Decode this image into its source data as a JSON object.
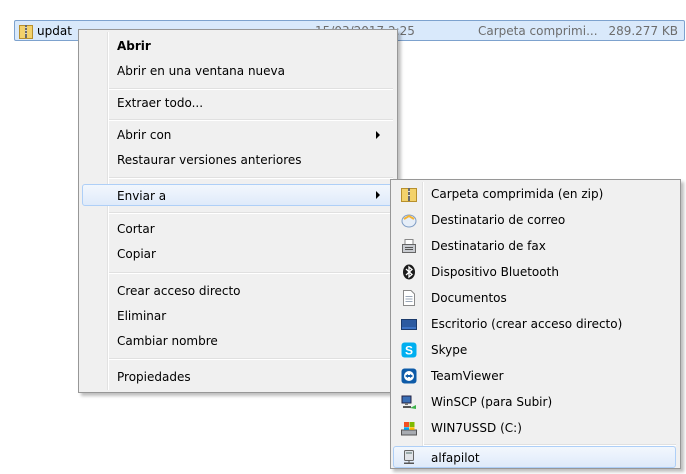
{
  "file": {
    "name": "updat",
    "date": "15/03/2017 2:25",
    "type": "Carpeta comprimi...",
    "size": "289.277 KB"
  },
  "context_menu": {
    "open": "Abrir",
    "open_new_window": "Abrir en una ventana nueva",
    "extract_all": "Extraer todo...",
    "open_with": "Abrir con",
    "restore_versions": "Restaurar versiones anteriores",
    "send_to": "Enviar a",
    "cut": "Cortar",
    "copy": "Copiar",
    "create_shortcut": "Crear acceso directo",
    "delete": "Eliminar",
    "rename": "Cambiar nombre",
    "properties": "Propiedades"
  },
  "send_to_menu": {
    "items": [
      {
        "label": "Carpeta comprimida (en zip)",
        "icon": "zip-folder-icon"
      },
      {
        "label": "Destinatario de correo",
        "icon": "mail-icon"
      },
      {
        "label": "Destinatario de fax",
        "icon": "fax-icon"
      },
      {
        "label": "Dispositivo Bluetooth",
        "icon": "bluetooth-icon"
      },
      {
        "label": "Documentos",
        "icon": "documents-icon"
      },
      {
        "label": "Escritorio (crear acceso directo)",
        "icon": "desktop-icon"
      },
      {
        "label": "Skype",
        "icon": "skype-icon"
      },
      {
        "label": "TeamViewer",
        "icon": "teamviewer-icon"
      },
      {
        "label": "WinSCP (para Subir)",
        "icon": "winscp-icon"
      },
      {
        "label": "WIN7USSD (C:)",
        "icon": "drive-icon"
      },
      {
        "label": "alfapilot",
        "icon": "network-drive-icon"
      }
    ]
  },
  "colors": {
    "selection": "#d9e9fb",
    "menu_bg": "#f0f0f0",
    "highlight_border": "#aecff7"
  }
}
